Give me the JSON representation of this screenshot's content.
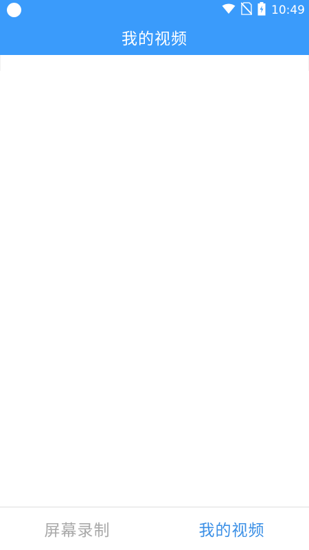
{
  "status_bar": {
    "time": "10:49",
    "icons": [
      "notification-dot-icon",
      "wifi-icon",
      "no-sim-icon",
      "battery-charging-icon"
    ]
  },
  "header": {
    "title": "我的视频"
  },
  "bottom_nav": {
    "tabs": [
      {
        "label": "屏幕录制",
        "active": false
      },
      {
        "label": "我的视频",
        "active": true
      }
    ]
  },
  "colors": {
    "header_bg": "#3a9bfb",
    "active_tab": "#3a8fe6",
    "inactive_tab": "#a9a9a9"
  }
}
